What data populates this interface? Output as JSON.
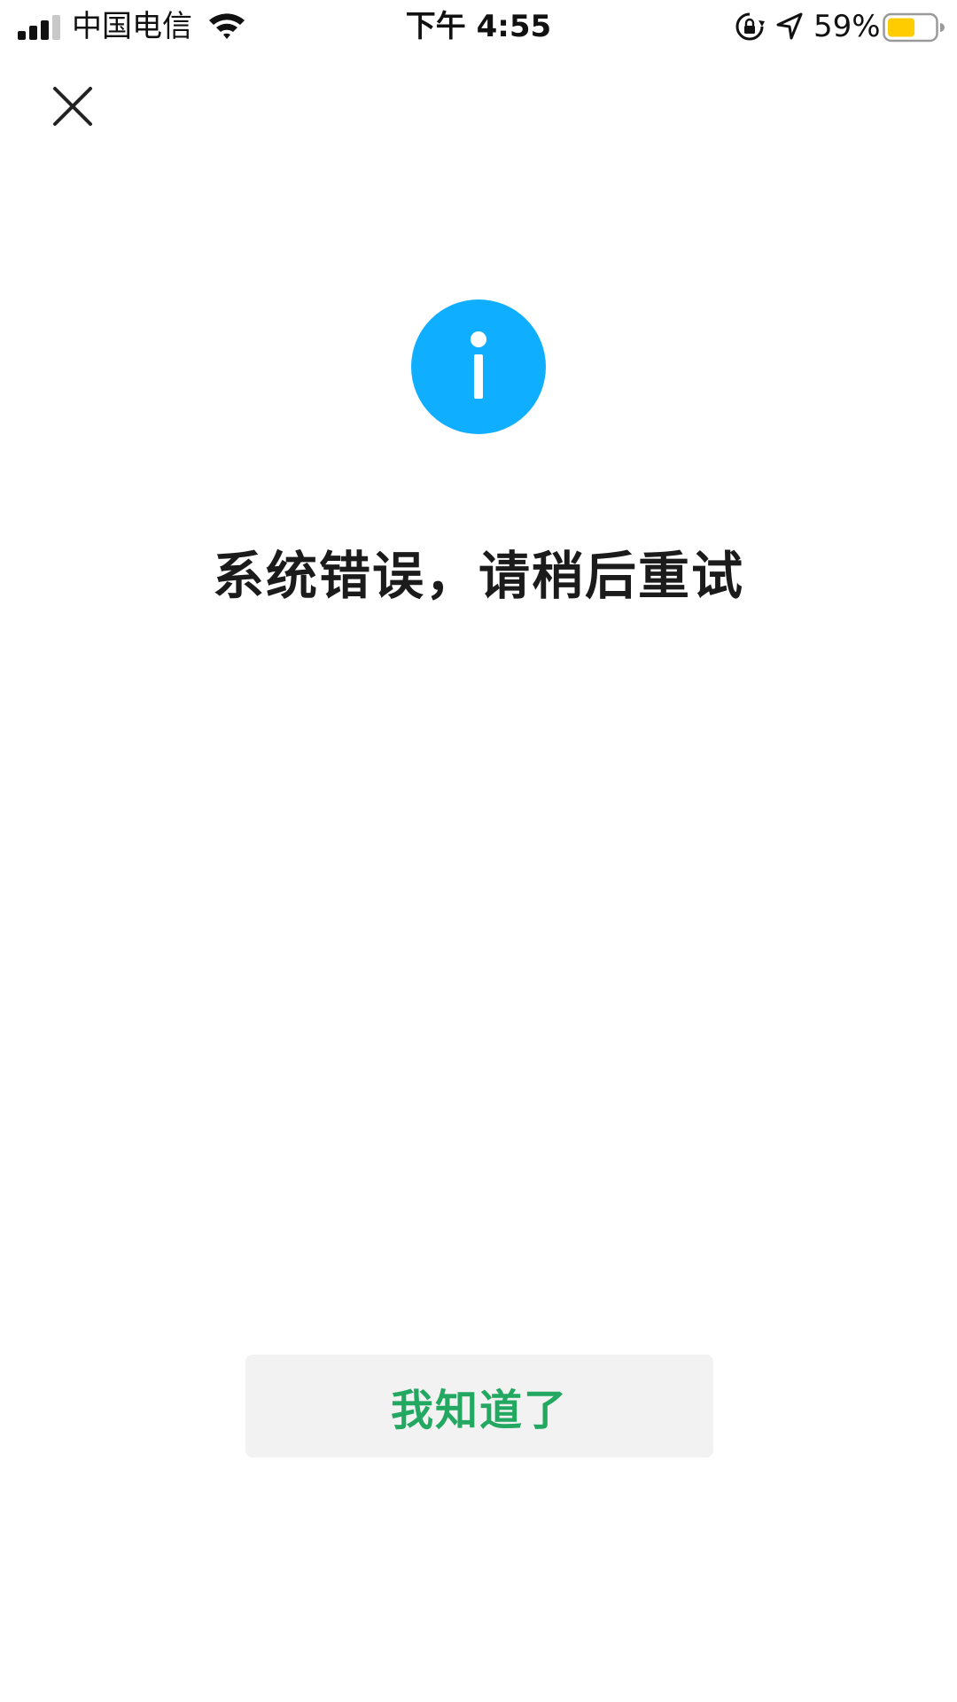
{
  "status_bar": {
    "carrier": "中国电信",
    "time": "下午 4:55",
    "battery_percent": "59%",
    "signal_bars": 3,
    "signal_bars_total": 4,
    "battery_level": 0.59,
    "icons": [
      "signal-icon",
      "wifi-icon",
      "rotation-lock-icon",
      "location-arrow-icon",
      "battery-icon"
    ]
  },
  "header": {
    "close_icon": "close-icon"
  },
  "main": {
    "icon": "info-icon",
    "message": "系统错误，请稍后重试"
  },
  "actions": {
    "acknowledge_label": "我知道了"
  },
  "colors": {
    "info_icon": "#10aeff",
    "button_text": "#22a861",
    "button_bg": "#f2f2f2",
    "battery_fill": "#ffcc00"
  }
}
